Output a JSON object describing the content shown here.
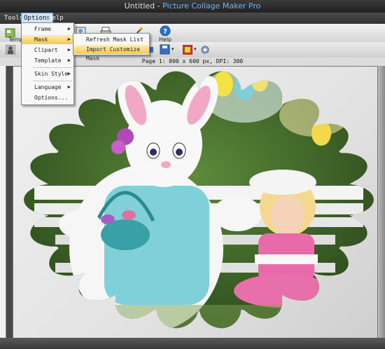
{
  "window": {
    "title_prefix": "Untitled - ",
    "app_name": "Picture Collage Maker Pro"
  },
  "menubar": {
    "tools": "Tools",
    "options": "Options",
    "help": "Help"
  },
  "toolbar": {
    "template_label": "Temp",
    "help_label": "Help"
  },
  "options_menu": {
    "items": [
      {
        "label": "Frame"
      },
      {
        "label": "Mask"
      },
      {
        "label": "Clipart"
      },
      {
        "label": "Template"
      },
      {
        "label": "Skin Style"
      },
      {
        "label": "Language"
      },
      {
        "label": "Options..."
      }
    ]
  },
  "mask_submenu": {
    "items": [
      {
        "label": "Refresh Mask List"
      },
      {
        "label": "Import Customize Mask"
      }
    ]
  },
  "page_info": "Page 1: 800 x 600 px, DPI: 300",
  "colors": {
    "accent": "#6fb4f0",
    "highlight": "#f6c94a",
    "help_icon": "#2a6fd0"
  }
}
